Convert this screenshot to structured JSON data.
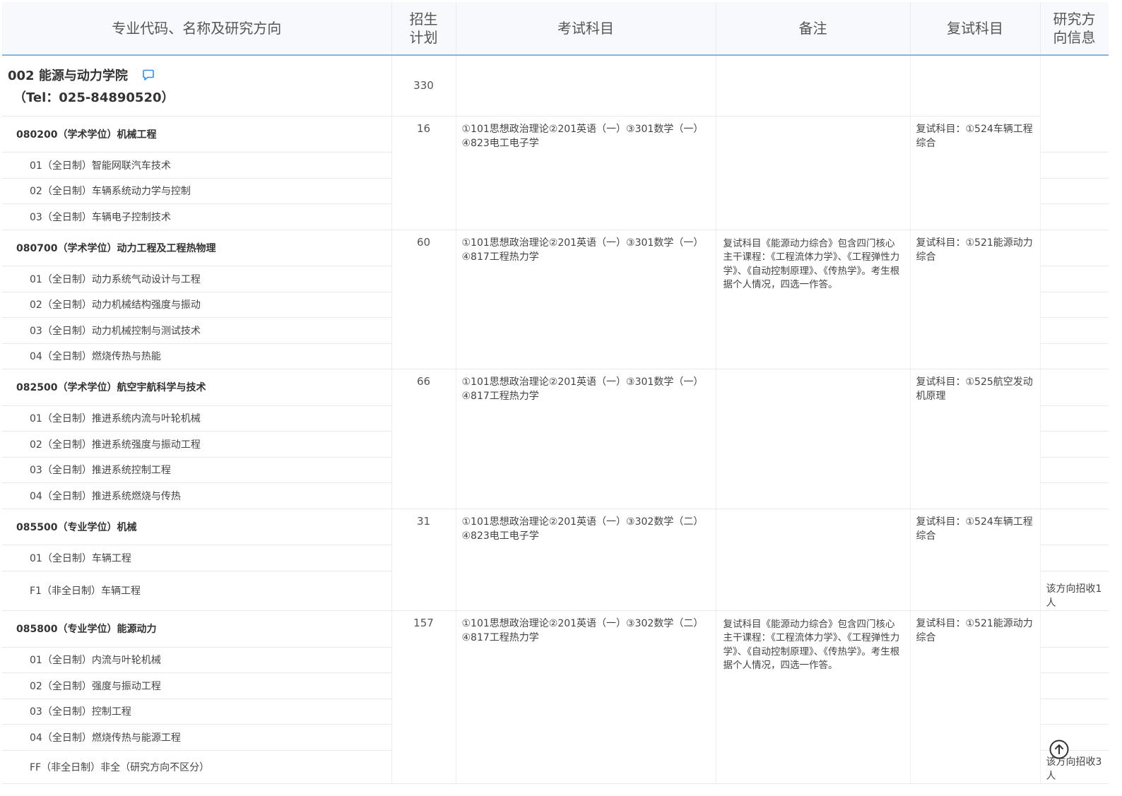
{
  "header": {
    "col_name": "专业代码、名称及研究方向",
    "col_plan": "招生计划",
    "col_plan_1": "招生",
    "col_plan_2": "计划",
    "col_exam": "考试科目",
    "col_note": "备注",
    "col_retest": "复试科目",
    "col_info_1": "研究方",
    "col_info_2": "向信息"
  },
  "college": {
    "name": "002 能源与动力学院",
    "tel": "（Tel：025-84890520）",
    "plan": "330"
  },
  "majors": [
    {
      "title": "080200（学术学位）机械工程",
      "plan": "16",
      "exam_line1": "①101思想政治理论②201英语（一）③301数学（一）",
      "exam_line2": "④823电工电子学",
      "note": "",
      "retest": "复试科目：①524车辆工程综合",
      "directions": [
        {
          "name": "01（全日制）智能网联汽车技术",
          "info": ""
        },
        {
          "name": "02（全日制）车辆系统动力学与控制",
          "info": ""
        },
        {
          "name": "03（全日制）车辆电子控制技术",
          "info": ""
        }
      ]
    },
    {
      "title": "080700（学术学位）动力工程及工程热物理",
      "plan": "60",
      "exam_line1": "①101思想政治理论②201英语（一）③301数学（一）",
      "exam_line2": "④817工程热力学",
      "note": "复试科目《能源动力综合》包含四门核心主干课程：《工程流体力学》、《工程弹性力学》、《自动控制原理》、《传热学》。考生根据个人情况，四选一作答。",
      "retest": "复试科目：①521能源动力综合",
      "directions": [
        {
          "name": "01（全日制）动力系统气动设计与工程",
          "info": ""
        },
        {
          "name": "02（全日制）动力机械结构强度与振动",
          "info": ""
        },
        {
          "name": "03（全日制）动力机械控制与测试技术",
          "info": ""
        },
        {
          "name": "04（全日制）燃烧传热与热能",
          "info": ""
        }
      ]
    },
    {
      "title": "082500（学术学位）航空宇航科学与技术",
      "plan": "66",
      "exam_line1": "①101思想政治理论②201英语（一）③301数学（一）",
      "exam_line2": "④817工程热力学",
      "note": "",
      "retest": "复试科目：①525航空发动机原理",
      "directions": [
        {
          "name": "01（全日制）推进系统内流与叶轮机械",
          "info": ""
        },
        {
          "name": "02（全日制）推进系统强度与振动工程",
          "info": ""
        },
        {
          "name": "03（全日制）推进系统控制工程",
          "info": ""
        },
        {
          "name": "04（全日制）推进系统燃烧与传热",
          "info": ""
        }
      ]
    },
    {
      "title": "085500（专业学位）机械",
      "plan": "31",
      "exam_line1": "①101思想政治理论②201英语（一）③302数学（二）",
      "exam_line2": "④823电工电子学",
      "note": "",
      "retest": "复试科目：①524车辆工程综合",
      "directions": [
        {
          "name": "01（全日制）车辆工程",
          "info": ""
        },
        {
          "name": "F1（非全日制）车辆工程",
          "info": "该方向招收1人"
        }
      ]
    },
    {
      "title": "085800（专业学位）能源动力",
      "plan": "157",
      "exam_line1": "①101思想政治理论②201英语（一）③302数学（二）",
      "exam_line2": "④817工程热力学",
      "note": "复试科目《能源动力综合》包含四门核心主干课程：《工程流体力学》、《工程弹性力学》、《自动控制原理》、《传热学》。考生根据个人情况，四选一作答。",
      "retest": "复试科目：①521能源动力综合",
      "directions": [
        {
          "name": "01（全日制）内流与叶轮机械",
          "info": ""
        },
        {
          "name": "02（全日制）强度与振动工程",
          "info": ""
        },
        {
          "name": "03（全日制）控制工程",
          "info": ""
        },
        {
          "name": "04（全日制）燃烧传热与能源工程",
          "info": ""
        },
        {
          "name": "FF（非全日制）非全（研究方向不区分）",
          "info": "该方向招收3人"
        }
      ]
    }
  ]
}
